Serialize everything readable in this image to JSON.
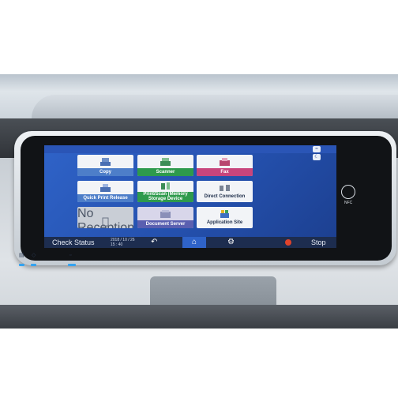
{
  "tiles": [
    {
      "label": "Copy",
      "band_color": "#4d7ec9",
      "icon": "copy-icon"
    },
    {
      "label": "Scanner",
      "band_color": "#2e9a4c",
      "icon": "scanner-icon"
    },
    {
      "label": "Fax",
      "band_color": "#c8457c",
      "icon": "fax-icon"
    },
    {
      "label": "Quick Print Release",
      "band_color": "#4d7ec9",
      "icon": "quick-print-icon"
    },
    {
      "label_line1": "Print/Scan (Memory",
      "label_line2": "Storage Device",
      "band_color": "#2e9a4c",
      "icon": "memory-storage-icon"
    },
    {
      "label": "Direct Connection",
      "icon": "direct-connection-icon"
    },
    {
      "label": "No Reception File",
      "icon": "document-icon"
    },
    {
      "label": "Document Server",
      "band_color": "#5a5fb0",
      "icon": "document-server-icon"
    },
    {
      "label": "Application Site",
      "icon": "application-site-icon"
    }
  ],
  "nav": {
    "check_status": "Check Status",
    "date": "2018 / 10 / 26",
    "time": "15 : 40",
    "back_glyph": "↶",
    "home_glyph": "⌂",
    "settings_glyph": "⚙",
    "stop": "Stop",
    "stop_color": "#e0432b"
  },
  "arrows": {
    "left": "‹",
    "right": "›"
  },
  "nfc": {
    "label": "NFC"
  },
  "status_icons": [
    "wifi-icon",
    "moon-icon"
  ],
  "colors": {
    "screen": "#2f63c8",
    "nav_bar": "#1d2d4f",
    "led": "#34a3f0"
  }
}
